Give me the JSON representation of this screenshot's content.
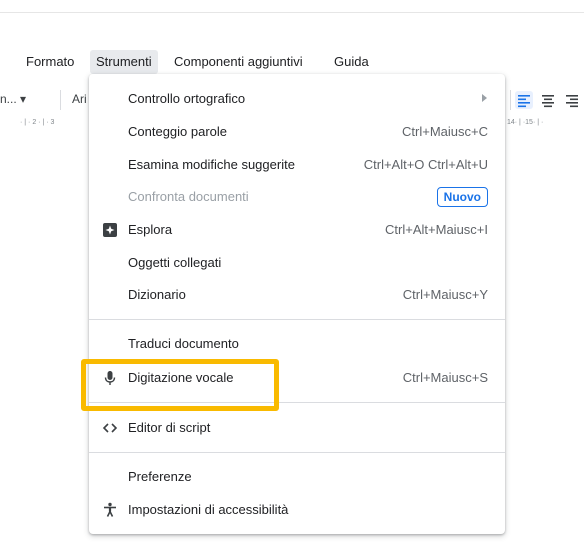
{
  "menubar": {
    "items": [
      "Formato",
      "Strumenti",
      "Componenti aggiuntivi",
      "Guida"
    ],
    "active_index": 1
  },
  "toolbar": {
    "style_text": "n... ▾",
    "font_text": "Ari",
    "align_icons": [
      "align-left-icon",
      "align-center-icon",
      "align-right-icon"
    ]
  },
  "ruler": {
    "left_ticks": "· | · 2 · | · 3",
    "right_ticks": "14· | ·15· | ·"
  },
  "tools_menu": {
    "items": [
      {
        "label": "Controllo ortografico",
        "submenu": true
      },
      {
        "label": "Conteggio parole",
        "shortcut": "Ctrl+Maiusc+C"
      },
      {
        "label": "Esamina modifiche suggerite",
        "shortcut": "Ctrl+Alt+O Ctrl+Alt+U"
      },
      {
        "label": "Confronta documenti",
        "badge": "Nuovo",
        "disabled": true
      },
      {
        "label": "Esplora",
        "shortcut": "Ctrl+Alt+Maiusc+I",
        "icon": "explore-icon"
      },
      {
        "label": "Oggetti collegati"
      },
      {
        "label": "Dizionario",
        "shortcut": "Ctrl+Maiusc+Y"
      },
      {
        "label": "Traduci documento"
      },
      {
        "label": "Digitazione vocale",
        "shortcut": "Ctrl+Maiusc+S",
        "icon": "microphone-icon",
        "highlighted": true
      },
      {
        "label": "Editor di script",
        "icon": "code-icon"
      },
      {
        "label": "Preferenze"
      },
      {
        "label": "Impostazioni di accessibilità",
        "icon": "accessibility-icon"
      }
    ]
  },
  "colors": {
    "highlight_border": "#f9ba00",
    "badge": "#1a73e8",
    "align_active": "#1a73e8"
  }
}
